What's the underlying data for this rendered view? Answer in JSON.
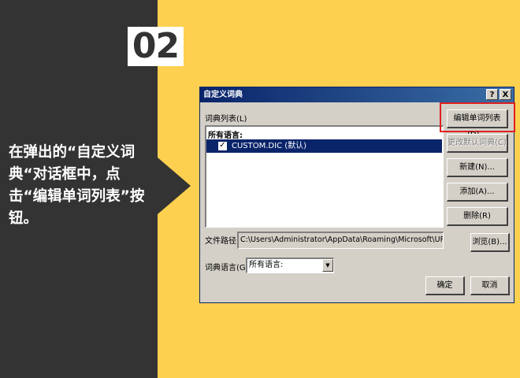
{
  "step": {
    "number": "02"
  },
  "instruction": {
    "text": "在弹出的“自定义词典“对话框中，点击“编辑单词列表”按钮。"
  },
  "dialog": {
    "title": "自定义词典",
    "help_label": "?",
    "close_label": "X",
    "list_label": "词典列表(L)",
    "list_header": "所有语言:",
    "list_items": [
      {
        "name": "CUSTOM.DIC (默认)",
        "checked": true,
        "selected": true
      }
    ],
    "buttons": {
      "edit_word_list": "编辑单词列表(D)...",
      "change_default": "更改默认词典(C)",
      "new": "新建(N)...",
      "add": "添加(A)...",
      "delete": "删除(R)",
      "browse": "浏览(B)...",
      "ok": "确定",
      "cancel": "取消"
    },
    "path_label": "文件路径:",
    "path_value": "C:\\Users\\Administrator\\AppData\\Roaming\\Microsoft\\UProof",
    "language_label": "词典语言(G):",
    "language_value": "所有语言:"
  },
  "colors": {
    "background": "#fdd04f",
    "panel": "#333333",
    "highlight": "#e02020",
    "selection": "#0a246a"
  }
}
